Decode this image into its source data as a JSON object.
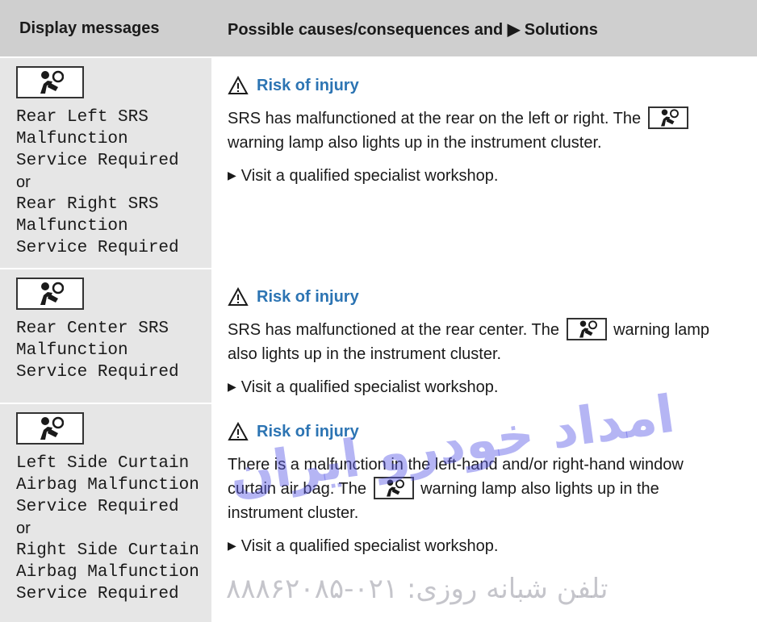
{
  "header": {
    "col1": "Display messages",
    "col2": "Possible causes/consequences and ▶ Solutions"
  },
  "icons": {
    "airbag": "airbag-warning-icon",
    "warning": "warning-triangle-icon"
  },
  "colors": {
    "header_bg": "#cfcfcf",
    "cell_bg": "#e6e6e6",
    "warning_blue": "#2c74b3"
  },
  "rows": [
    {
      "msg1": "Rear Left SRS",
      "msg2": "Malfunction",
      "msg3": "Service Required",
      "or": "or",
      "msg4": "Rear Right SRS",
      "msg5": "Malfunction",
      "msg6": "Service Required",
      "warning": "Risk of injury",
      "p1a": "SRS has malfunctioned at the rear on the left or right. The",
      "p2": "warning lamp also lights up in the instrument cluster.",
      "action": "Visit a qualified specialist workshop."
    },
    {
      "msg1": "Rear Center SRS",
      "msg2": "Malfunction",
      "msg3": "Service Required",
      "warning": "Risk of injury",
      "p1a": "SRS has malfunctioned at the rear center. The",
      "p1b": "warning lamp",
      "p2": "also lights up in the instrument cluster.",
      "action": "Visit a qualified specialist workshop."
    },
    {
      "msg1": "Left Side Curtain",
      "msg2": "Airbag Malfunction",
      "msg3": "Service Required",
      "or": "or",
      "msg4": "Right Side Curtain",
      "msg5": "Airbag Malfunction",
      "msg6": "Service Required",
      "warning": "Risk of injury",
      "p1": "There is a malfunction in the left-hand and/or right-hand window",
      "p2a": "curtain air bag. The",
      "p2b": "warning lamp also lights up in the",
      "p3": "instrument cluster.",
      "action": "Visit a qualified specialist workshop."
    }
  ],
  "watermark": {
    "text1": "امداد خودرو ایران",
    "text2": "تلفن شبانه روزی: ۰۲۱-۸۸۸۶۲۰۸۵"
  }
}
